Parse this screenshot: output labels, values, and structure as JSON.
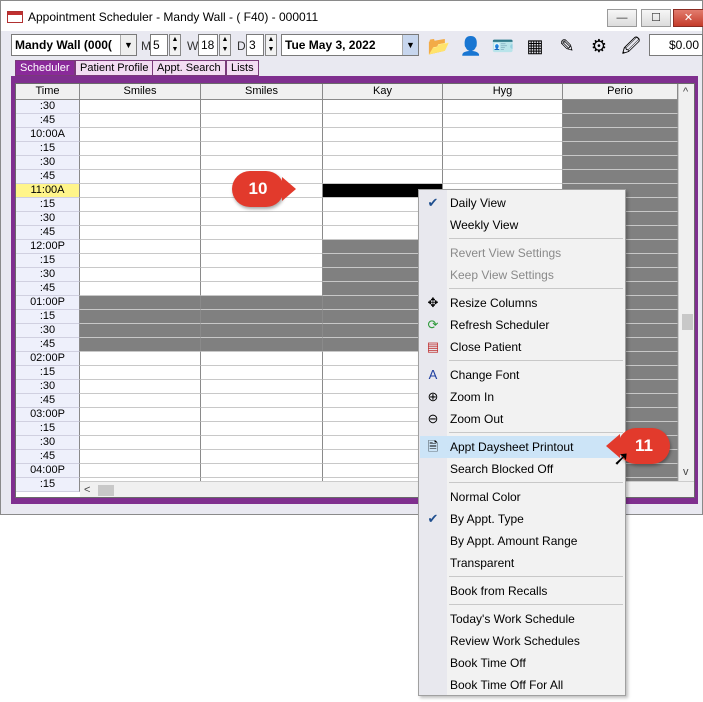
{
  "window": {
    "title": "Appointment Scheduler - Mandy Wall - ( F40) - 000011",
    "minimize_glyph": "—",
    "maximize_glyph": "☐",
    "close_glyph": "✕"
  },
  "toolbar": {
    "patient_combo": "Mandy Wall (000(",
    "m_label": "M",
    "m_value": "5",
    "w_label": "W",
    "w_value": "18",
    "d_label": "D",
    "d_value": "3",
    "date_value": "Tue  May 3, 2022",
    "balance": "$0.00",
    "icons": [
      "folder-icon",
      "patient-icon",
      "id-card-icon",
      "calendar-grid-icon",
      "pencil-icon",
      "settings-icon",
      "notes-icon"
    ]
  },
  "tabs": [
    {
      "label": "Scheduler",
      "active": true
    },
    {
      "label": "Patient Profile",
      "active": false
    },
    {
      "label": "Appt. Search",
      "active": false
    },
    {
      "label": "Lists",
      "active": false
    }
  ],
  "grid": {
    "time_header": "Time",
    "columns": [
      "Smiles",
      "Smiles",
      "Kay",
      "Hyg",
      "Perio"
    ],
    "times": [
      ":30",
      ":45",
      "10:00A",
      ":15",
      ":30",
      ":45",
      "11:00A",
      ":15",
      ":30",
      ":45",
      "12:00P",
      ":15",
      ":30",
      ":45",
      "01:00P",
      ":15",
      ":30",
      ":45",
      "02:00P",
      ":15",
      ":30",
      ":45",
      "03:00P",
      ":15",
      ":30",
      ":45",
      "04:00P",
      ":15"
    ],
    "highlighted_time": "11:00A"
  },
  "context_menu": {
    "items": [
      {
        "label": "Daily View",
        "checked": true,
        "disabled": false,
        "icon": "check-icon"
      },
      {
        "label": "Weekly View",
        "disabled": false
      },
      {
        "sep": true
      },
      {
        "label": "Revert View Settings",
        "disabled": true
      },
      {
        "label": "Keep View Settings",
        "disabled": true
      },
      {
        "sep": true
      },
      {
        "label": "Resize Columns",
        "icon": "resize-arrows-icon"
      },
      {
        "label": "Refresh Scheduler",
        "icon": "refresh-icon"
      },
      {
        "label": "Close Patient",
        "icon": "close-patient-icon"
      },
      {
        "sep": true
      },
      {
        "label": "Change Font",
        "icon": "font-icon"
      },
      {
        "label": "Zoom In",
        "icon": "zoom-in-icon"
      },
      {
        "label": "Zoom Out",
        "icon": "zoom-out-icon"
      },
      {
        "sep": true
      },
      {
        "label": "Appt Daysheet Printout",
        "icon": "document-icon",
        "hover": true
      },
      {
        "label": "Search Blocked Off"
      },
      {
        "sep": true
      },
      {
        "label": "Normal Color"
      },
      {
        "label": "By Appt. Type",
        "checked": true
      },
      {
        "label": "By Appt. Amount Range"
      },
      {
        "label": "Transparent"
      },
      {
        "sep": true
      },
      {
        "label": "Book from Recalls"
      },
      {
        "sep": true
      },
      {
        "label": "Today's Work Schedule"
      },
      {
        "label": "Review Work Schedules"
      },
      {
        "label": "Book Time Off"
      },
      {
        "label": "Book Time Off For All"
      }
    ]
  },
  "callouts": {
    "step_a": "10",
    "step_b": "11"
  },
  "colors": {
    "tab_active": "#8a2a9a",
    "blocked": "#808080",
    "highlight": "#fff58a",
    "menu_hover": "#cce4f7",
    "callout": "#e23a2c"
  }
}
